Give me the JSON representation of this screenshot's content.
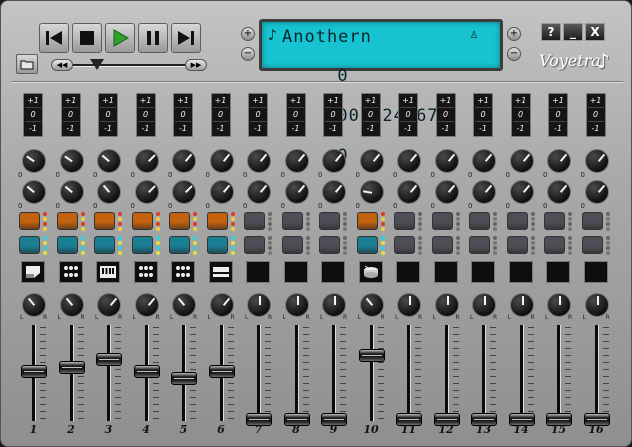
{
  "app": {
    "song_title": "Anothern",
    "time": "000:24:67",
    "left_counter": "0",
    "right_counter": "0",
    "logo": "Voyetra",
    "window_buttons": [
      "?",
      "_",
      "X"
    ],
    "seek_position": 0.25
  },
  "transport": [
    {
      "name": "skip-back",
      "icon": "skip-to-start-icon"
    },
    {
      "name": "stop",
      "icon": "stop-icon"
    },
    {
      "name": "play",
      "icon": "play-icon"
    },
    {
      "name": "pause",
      "icon": "pause-icon"
    },
    {
      "name": "skip-forward",
      "icon": "skip-to-end-icon"
    }
  ],
  "transpose_labels": [
    "+1",
    "0",
    "-1"
  ],
  "knob_zero": "0",
  "pan_labels": {
    "left": "L",
    "right": "R"
  },
  "colors": {
    "mute_active": "#c2620e",
    "solo_active": "#1b7f94",
    "pad_inactive": "#4e4e56",
    "lcd": "#17c3d0",
    "play_green": "#2fa12a"
  },
  "channels": [
    {
      "number": "1",
      "active": true,
      "instrument": "piano-icon",
      "fader": 0.56,
      "k1": -55,
      "k2": -50,
      "pan": -40
    },
    {
      "number": "2",
      "active": true,
      "instrument": "drums-icon",
      "fader": 0.6,
      "k1": -55,
      "k2": -50,
      "pan": -40
    },
    {
      "number": "3",
      "active": true,
      "instrument": "keyboard-icon",
      "fader": 0.7,
      "k1": -50,
      "k2": -40,
      "pan": 40
    },
    {
      "number": "4",
      "active": true,
      "instrument": "drums-icon",
      "fader": 0.56,
      "k1": 45,
      "k2": 45,
      "pan": 40
    },
    {
      "number": "5",
      "active": true,
      "instrument": "drums-icon",
      "fader": 0.48,
      "k1": 40,
      "k2": 45,
      "pan": -40
    },
    {
      "number": "6",
      "active": true,
      "instrument": "organ-icon",
      "fader": 0.56,
      "k1": 40,
      "k2": 40,
      "pan": 40
    },
    {
      "number": "7",
      "active": false,
      "instrument": "",
      "fader": 0.0,
      "k1": 40,
      "k2": 40,
      "pan": 0
    },
    {
      "number": "8",
      "active": false,
      "instrument": "",
      "fader": 0.0,
      "k1": 40,
      "k2": 40,
      "pan": 0
    },
    {
      "number": "9",
      "active": false,
      "instrument": "",
      "fader": 0.0,
      "k1": 40,
      "k2": 40,
      "pan": 0
    },
    {
      "number": "10",
      "active": true,
      "instrument": "snare-drum-icon",
      "fader": 0.74,
      "k1": 40,
      "k2": -80,
      "pan": -40
    },
    {
      "number": "11",
      "active": false,
      "instrument": "",
      "fader": 0.0,
      "k1": 40,
      "k2": 40,
      "pan": 0
    },
    {
      "number": "12",
      "active": false,
      "instrument": "",
      "fader": 0.0,
      "k1": 40,
      "k2": 40,
      "pan": 0
    },
    {
      "number": "13",
      "active": false,
      "instrument": "",
      "fader": 0.0,
      "k1": 40,
      "k2": 40,
      "pan": 0
    },
    {
      "number": "14",
      "active": false,
      "instrument": "",
      "fader": 0.0,
      "k1": 40,
      "k2": 40,
      "pan": 0
    },
    {
      "number": "15",
      "active": false,
      "instrument": "",
      "fader": 0.0,
      "k1": 40,
      "k2": 40,
      "pan": 0
    },
    {
      "number": "16",
      "active": false,
      "instrument": "",
      "fader": 0.0,
      "k1": 40,
      "k2": 40,
      "pan": 0
    }
  ]
}
